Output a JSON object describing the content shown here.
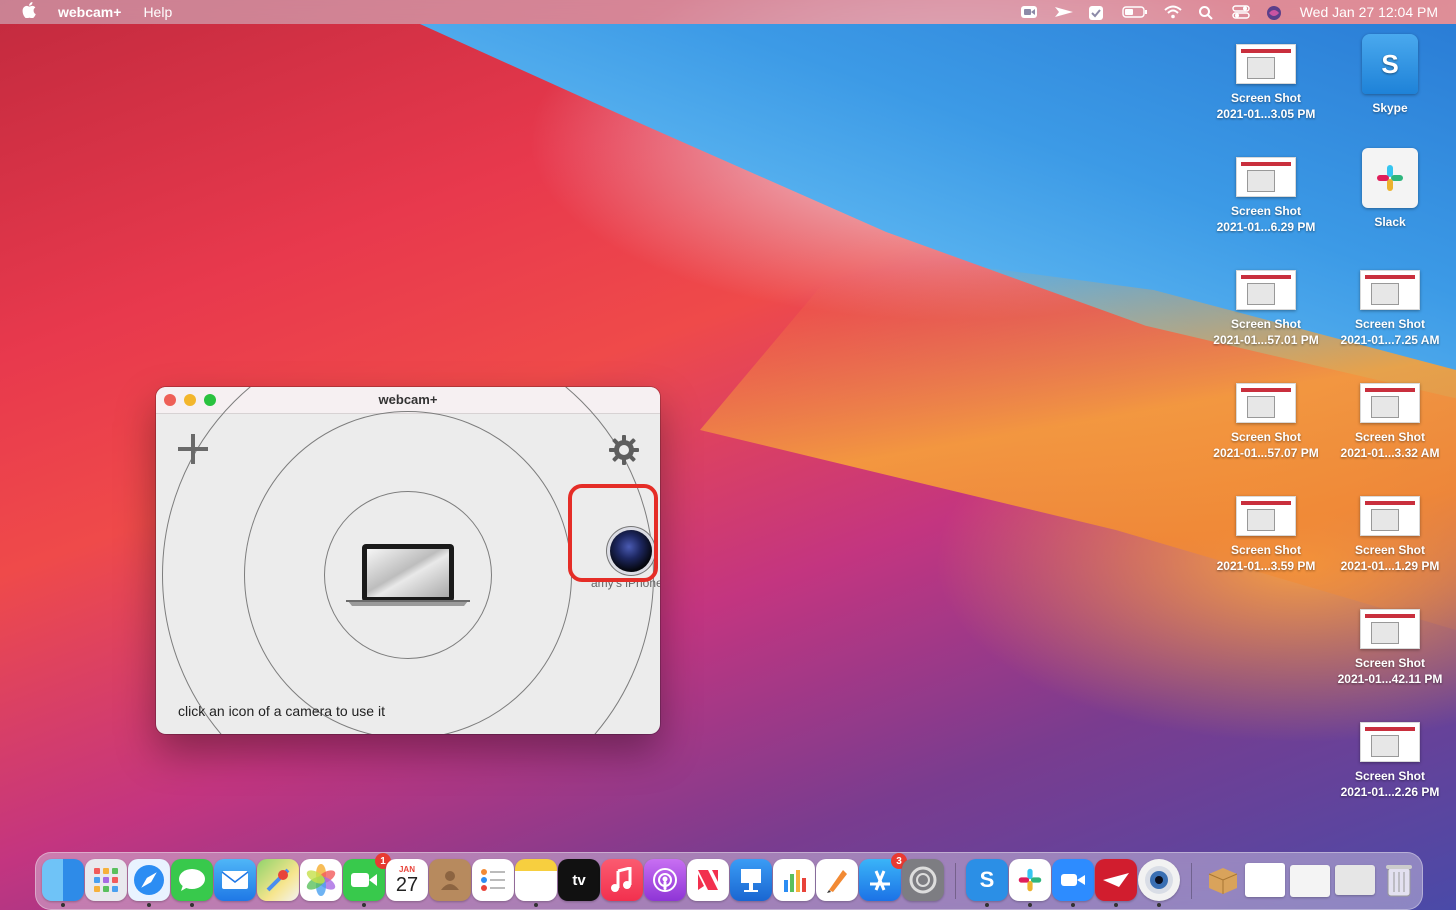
{
  "menubar": {
    "app_name": "webcam+",
    "menus": [
      "Help"
    ],
    "clock": "Wed Jan 27  12:04 PM",
    "status_icons": [
      "zoom-icon",
      "direct-icon",
      "checkmark-icon",
      "battery-icon",
      "wifi-icon",
      "spotlight-icon",
      "control-center-icon",
      "siri-icon"
    ]
  },
  "desktop_icons": [
    {
      "line1": "Screen Shot",
      "line2": "2021-01...3.05 PM"
    },
    {
      "line1": "Skype",
      "line2": ""
    },
    {
      "line1": "Screen Shot",
      "line2": "2021-01...6.29 PM"
    },
    {
      "line1": "Slack",
      "line2": ""
    },
    {
      "line1": "Screen Shot",
      "line2": "2021-01...57.01 PM"
    },
    {
      "line1": "Screen Shot",
      "line2": "2021-01...7.25 AM"
    },
    {
      "line1": "Screen Shot",
      "line2": "2021-01...57.07 PM"
    },
    {
      "line1": "Screen Shot",
      "line2": "2021-01...3.32 AM"
    },
    {
      "line1": "Screen Shot",
      "line2": "2021-01...3.59 PM"
    },
    {
      "line1": "Screen Shot",
      "line2": "2021-01...1.29 PM"
    },
    {
      "line1": "Screen Shot",
      "line2": "2021-01...42.11 PM"
    },
    {
      "line1": "Screen Shot",
      "line2": "2021-01...2.26 PM"
    }
  ],
  "window": {
    "title": "webcam+",
    "camera_label": "amy's iPhone",
    "hint": "click an icon of a camera to use it"
  },
  "dock": {
    "calendar_month": "JAN",
    "calendar_day": "27",
    "facetime_badge": "1",
    "appstore_badge": "3",
    "tv_label": "tv"
  },
  "colors": {
    "highlight": "#e52d27"
  }
}
